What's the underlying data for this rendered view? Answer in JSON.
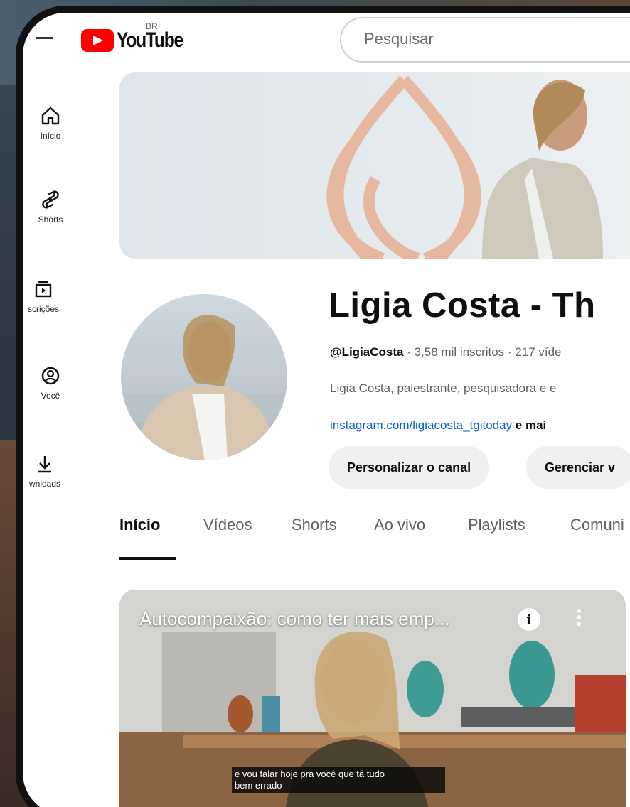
{
  "header": {
    "logo_text": "YouTube",
    "region": "BR",
    "search_placeholder": "Pesquisar"
  },
  "sidebar": {
    "items": [
      {
        "label": "Início",
        "icon": "home-icon"
      },
      {
        "label": "Shorts",
        "icon": "shorts-icon"
      },
      {
        "label": "scrições",
        "icon": "subscriptions-icon"
      },
      {
        "label": "Você",
        "icon": "you-icon"
      },
      {
        "label": "wnloads",
        "icon": "download-icon"
      }
    ]
  },
  "channel": {
    "title": "Ligia Costa - Th",
    "handle": "@LigiaCosta",
    "meta_rest": " · 3,58 mil inscritos · 217 víde",
    "description": "Ligia Costa, palestrante, pesquisadora e e",
    "link": "instagram.com/ligiacosta_tgitoday",
    "more": " e mai",
    "buttons": {
      "customize": "Personalizar o canal",
      "manage": "Gerenciar v"
    }
  },
  "tabs": [
    {
      "label": "Início",
      "active": true
    },
    {
      "label": "Vídeos",
      "active": false
    },
    {
      "label": "Shorts",
      "active": false
    },
    {
      "label": "Ao vivo",
      "active": false
    },
    {
      "label": "Playlists",
      "active": false
    },
    {
      "label": "Comuni",
      "active": false
    }
  ],
  "video": {
    "title": "Autocompaixão: como ter mais emp...",
    "caption_line1": "e vou falar hoje pra você que tá tudo",
    "caption_line2": "bem errado"
  },
  "colors": {
    "youtube_red": "#ff0000",
    "link_blue": "#065fd4",
    "text_primary": "#0f0f0f",
    "text_secondary": "#606060",
    "button_bg": "#f0f0f0",
    "banner_logo": "#e7b8a0"
  }
}
